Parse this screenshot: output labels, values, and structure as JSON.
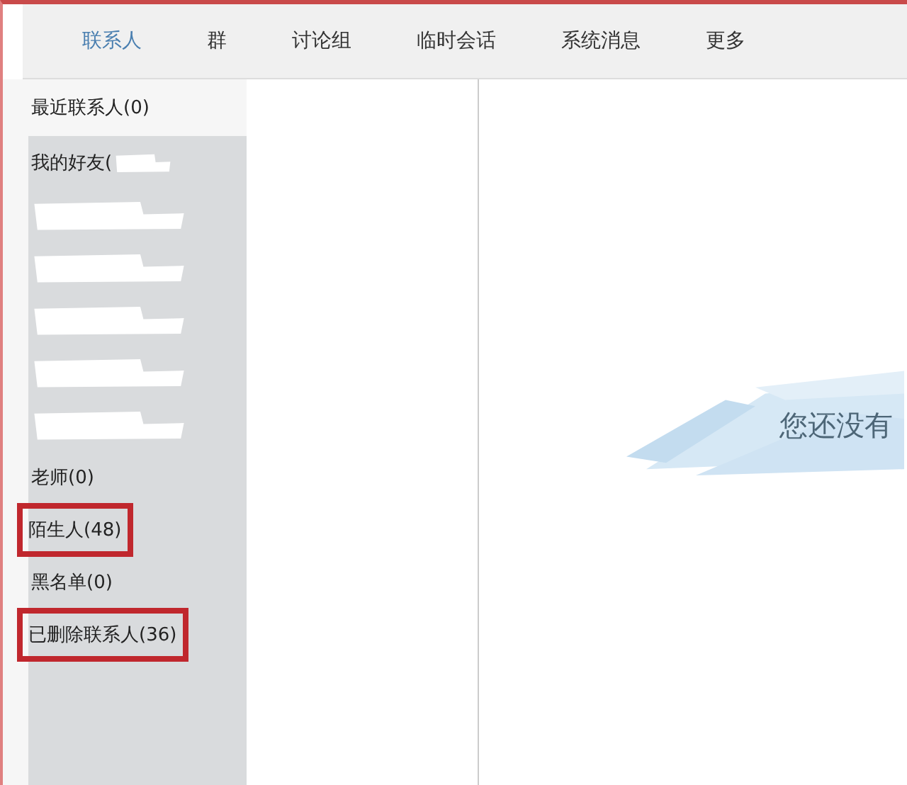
{
  "tabs": [
    {
      "label": "联系人",
      "selected": true
    },
    {
      "label": "群",
      "selected": false
    },
    {
      "label": "讨论组",
      "selected": false
    },
    {
      "label": "临时会话",
      "selected": false
    },
    {
      "label": "系统消息",
      "selected": false
    },
    {
      "label": "更多",
      "selected": false
    }
  ],
  "recent": {
    "label": "最近联系人(0)"
  },
  "groups": [
    {
      "kind": "group",
      "label": "我的好友(",
      "redacted": true,
      "highlighted": false
    },
    {
      "kind": "redacted"
    },
    {
      "kind": "redacted"
    },
    {
      "kind": "redacted"
    },
    {
      "kind": "redacted"
    },
    {
      "kind": "redacted"
    },
    {
      "kind": "group",
      "label": "老师(0)",
      "redacted": false,
      "highlighted": false
    },
    {
      "kind": "group",
      "label": "陌生人(48)",
      "redacted": false,
      "highlighted": true
    },
    {
      "kind": "group",
      "label": "黑名单(0)",
      "redacted": false,
      "highlighted": false
    },
    {
      "kind": "group",
      "label": "已删除联系人(36)",
      "redacted": false,
      "highlighted": true
    }
  ],
  "empty_message": "您还没有"
}
